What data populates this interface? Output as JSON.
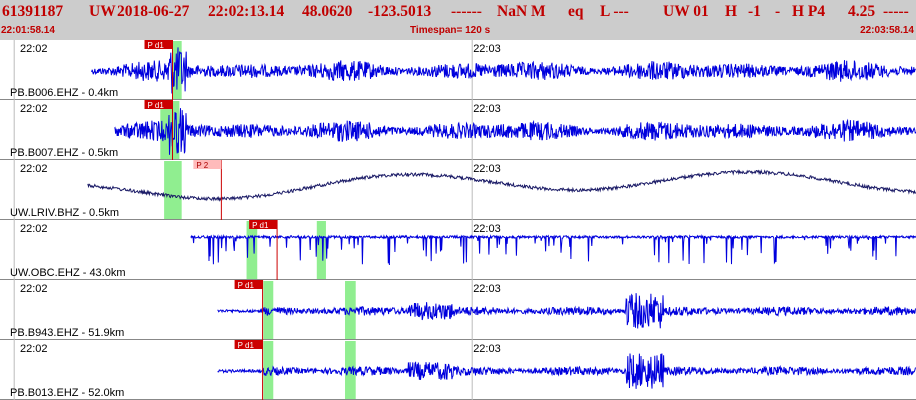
{
  "header": {
    "event_id": "61391187",
    "network": "UW",
    "date": "2018-06-27",
    "time": "22:02:13.14",
    "lat": "48.0620",
    "lon": "-123.5013",
    "depth_placeholder": "------",
    "magnitude": "NaN M",
    "event_type": "eq",
    "location_flag": "L ---",
    "source": "UW 01",
    "quality_h": "H",
    "quality_val": "-1",
    "dash": "-",
    "quality_p": "H P4",
    "rms": "4.25",
    "trailing": "-----"
  },
  "subheader": {
    "start_time": "22:01:58.14",
    "timespan": "Timespan= 120 s",
    "end_time": "22:03:58.14"
  },
  "time_span_seconds": 120,
  "start_seconds_in_day": 79318.14,
  "colors": {
    "header_bg": "#cccccc",
    "header_text": "#c00000",
    "trace_blue": "#0000dd",
    "trace_navy": "#1a1a66",
    "pick_red": "#cc0000",
    "pick_pink": "#ffbbbb",
    "pick_window_green": "#90ee90",
    "channel_label": "#000000",
    "separator": "#888888"
  },
  "panels": [
    {
      "label": "PB.B006.EHZ",
      "distance": "0.4km",
      "time_left": "22:02",
      "time_mid": "22:03",
      "pick": "P d1",
      "pick_style": "red",
      "pick_time": 22.6,
      "pick_windows": [
        {
          "start": 22.6,
          "end": 23.8
        }
      ],
      "trace_style": "dense_noise",
      "trace_color": "blue",
      "trace_start": 12.0
    },
    {
      "label": "PB.B007.EHZ",
      "distance": "0.5km",
      "time_left": "22:02",
      "time_mid": "22:03",
      "pick": "P d1",
      "pick_style": "red",
      "pick_time": 22.6,
      "pick_windows": [
        {
          "start": 21.0,
          "end": 23.5
        }
      ],
      "trace_style": "dense_noise",
      "trace_color": "blue",
      "trace_start": 15.0
    },
    {
      "label": "UW.LRIV.BHZ",
      "distance": "0.5km",
      "time_left": "22:02",
      "time_mid": "22:03",
      "pick": "P 2",
      "pick_style": "pink",
      "pick_time": 29.0,
      "pick_windows": [
        {
          "start": 21.5,
          "end": 23.8
        }
      ],
      "trace_style": "long_period",
      "trace_color": "navy",
      "trace_start": 11.5
    },
    {
      "label": "UW.OBC.EHZ",
      "distance": "43.0km",
      "time_left": "22:02",
      "time_mid": "22:03",
      "pick": "P d1",
      "pick_style": "red",
      "pick_time": 36.3,
      "pick_windows": [
        {
          "start": 32.3,
          "end": 33.7
        },
        {
          "start": 41.5,
          "end": 42.7
        }
      ],
      "trace_style": "spiky",
      "trace_color": "blue",
      "trace_start": 25.0
    },
    {
      "label": "PB.B943.EHZ",
      "distance": "51.9km",
      "time_left": "22:02",
      "time_mid": "22:03",
      "pick": "P d1",
      "pick_style": "red",
      "pick_time": 34.4,
      "pick_windows": [
        {
          "start": 34.5,
          "end": 35.8
        },
        {
          "start": 45.2,
          "end": 46.6
        }
      ],
      "trace_style": "bursty",
      "trace_color": "blue",
      "trace_start": 28.5
    },
    {
      "label": "PB.B013.EHZ",
      "distance": "52.0km",
      "time_left": "22:02",
      "time_mid": "22:03",
      "pick": "P d1",
      "pick_style": "red",
      "pick_time": 34.4,
      "pick_windows": [
        {
          "start": 34.5,
          "end": 35.8
        },
        {
          "start": 45.2,
          "end": 46.6
        }
      ],
      "trace_style": "bursty",
      "trace_color": "blue",
      "trace_start": 28.5
    }
  ]
}
